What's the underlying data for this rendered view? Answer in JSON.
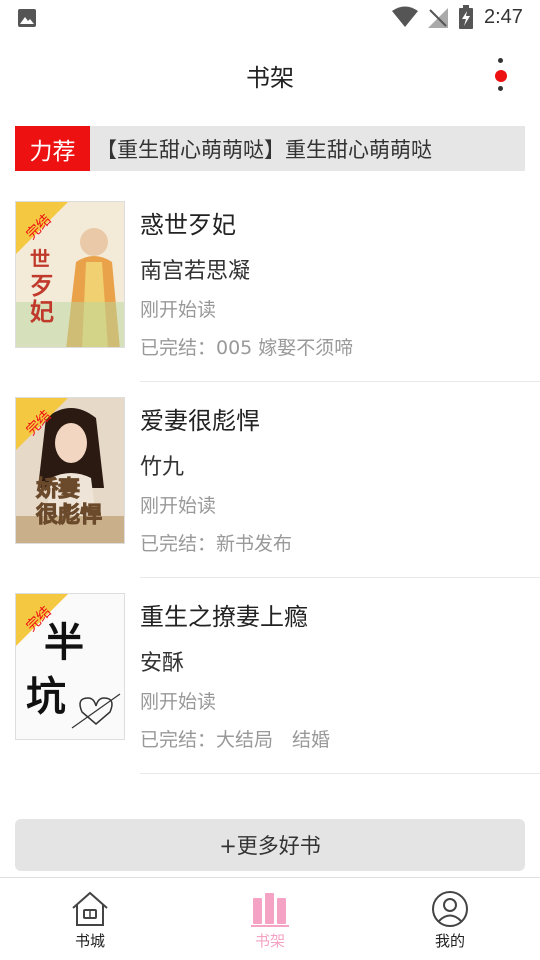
{
  "status_bar": {
    "time": "2:47"
  },
  "header": {
    "title": "书架"
  },
  "recommend": {
    "tag": "力荐",
    "text": "【重生甜心萌萌哒】重生甜心萌萌哒"
  },
  "books": [
    {
      "title": "惑世歹妃",
      "author": "南宫若思凝",
      "progress": "刚开始读",
      "status": "已完结：005 嫁娶不须啼",
      "badge": "完结",
      "cover_text": "惑世歹妃",
      "cover_colors": [
        "#f4ead8",
        "#e9a24a",
        "#c0392b"
      ]
    },
    {
      "title": "爱妻很彪悍",
      "author": "竹九",
      "progress": "刚开始读",
      "status": "已完结：新书发布",
      "badge": "完结",
      "cover_text": "娇妻很彪悍",
      "cover_colors": [
        "#e6d9c8",
        "#8c6c4a",
        "#6b4a2b"
      ]
    },
    {
      "title": "重生之撩妻上瘾",
      "author": "安酥",
      "progress": "刚开始读",
      "status": "已完结：大结局　结婚",
      "badge": "完结",
      "cover_text": "半坑",
      "cover_colors": [
        "#fafafa",
        "#111111",
        "#c0392b"
      ]
    }
  ],
  "more_books": {
    "label": "+更多好书"
  },
  "bottom_nav": [
    {
      "label": "书城",
      "icon": "home-icon",
      "active": false
    },
    {
      "label": "书架",
      "icon": "bookshelf-icon",
      "active": true
    },
    {
      "label": "我的",
      "icon": "profile-icon",
      "active": false
    }
  ],
  "colors": {
    "accent_red": "#ee1111",
    "active_pink": "#f5a3c4",
    "badge_yellow": "#f5c842"
  }
}
